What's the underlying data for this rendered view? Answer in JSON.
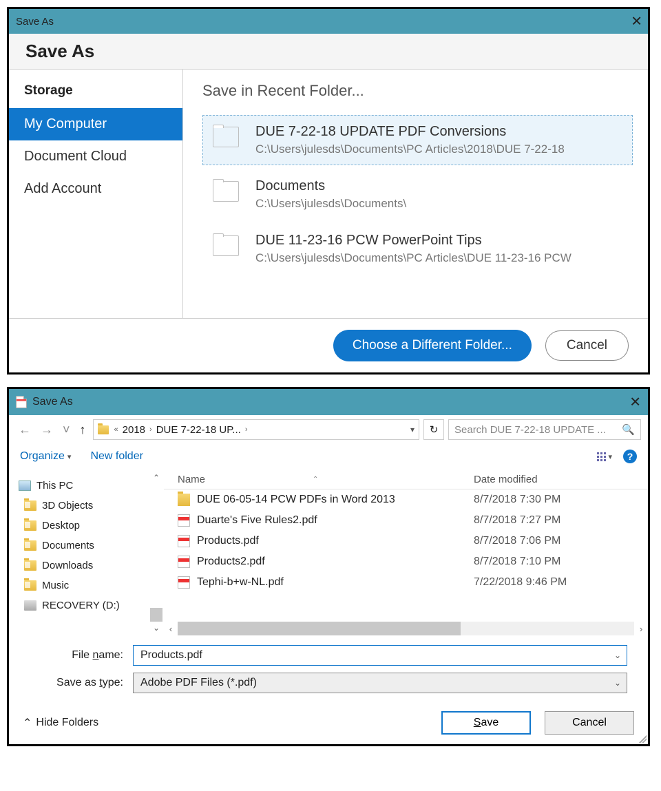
{
  "win1": {
    "title": "Save As",
    "heading": "Save As",
    "sidebar": {
      "heading": "Storage",
      "items": [
        {
          "label": "My Computer",
          "selected": true
        },
        {
          "label": "Document Cloud",
          "selected": false
        },
        {
          "label": "Add Account",
          "selected": false
        }
      ]
    },
    "recentHeading": "Save in Recent Folder...",
    "recentFolders": [
      {
        "name": "DUE 7-22-18 UPDATE PDF Conversions",
        "path": "C:\\Users\\julesds\\Documents\\PC Articles\\2018\\DUE 7-22-18 ",
        "selected": true
      },
      {
        "name": "Documents",
        "path": "C:\\Users\\julesds\\Documents\\",
        "selected": false
      },
      {
        "name": "DUE 11-23-16 PCW PowerPoint Tips",
        "path": "C:\\Users\\julesds\\Documents\\PC Articles\\DUE 11-23-16 PCW",
        "selected": false
      }
    ],
    "buttons": {
      "choose": "Choose a Different Folder...",
      "cancel": "Cancel"
    }
  },
  "win2": {
    "title": "Save As",
    "breadcrumb": {
      "doubleChevron": "«",
      "segments": [
        "2018",
        "DUE 7-22-18 UP..."
      ]
    },
    "searchPlaceholder": "Search DUE 7-22-18 UPDATE ...",
    "toolbar": {
      "organize": "Organize",
      "newFolder": "New folder"
    },
    "tree": [
      {
        "label": "This PC",
        "icon": "computer",
        "root": true
      },
      {
        "label": "3D Objects",
        "icon": "folder"
      },
      {
        "label": "Desktop",
        "icon": "folder"
      },
      {
        "label": "Documents",
        "icon": "folder"
      },
      {
        "label": "Downloads",
        "icon": "folder"
      },
      {
        "label": "Music",
        "icon": "folder"
      },
      {
        "label": "RECOVERY (D:)",
        "icon": "drive"
      }
    ],
    "columns": {
      "name": "Name",
      "date": "Date modified"
    },
    "files": [
      {
        "name": "DUE 06-05-14 PCW PDFs in Word 2013",
        "type": "folder",
        "date": "8/7/2018 7:30 PM"
      },
      {
        "name": "Duarte's Five Rules2.pdf",
        "type": "pdf",
        "date": "8/7/2018 7:27 PM"
      },
      {
        "name": "Products.pdf",
        "type": "pdf",
        "date": "8/7/2018 7:06 PM"
      },
      {
        "name": "Products2.pdf",
        "type": "pdf",
        "date": "8/7/2018 7:10 PM"
      },
      {
        "name": "Tephi-b+w-NL.pdf",
        "type": "pdf",
        "date": "7/22/2018 9:46 PM"
      }
    ],
    "form": {
      "fileNameLabelPrefix": "File ",
      "fileNameLabelU": "n",
      "fileNameLabelSuffix": "ame:",
      "fileNameValue": "Products.pdf",
      "saveTypeLabelPrefix": "Save as ",
      "saveTypeLabelU": "t",
      "saveTypeLabelSuffix": "ype:",
      "saveTypeValue": "Adobe PDF Files (*.pdf)"
    },
    "footer": {
      "hide": "Hide Folders",
      "saveU": "S",
      "saveRest": "ave",
      "cancel": "Cancel"
    }
  }
}
